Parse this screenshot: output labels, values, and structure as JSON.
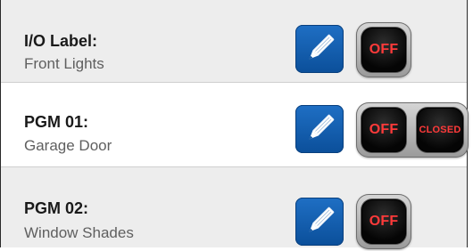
{
  "rows": [
    {
      "title": "I/O Label:",
      "subtitle": "Front Lights",
      "edit_icon": "pencil-icon",
      "toggle": "OFF"
    },
    {
      "title": "PGM 01:",
      "subtitle": "Garage Door",
      "edit_icon": "pencil-icon",
      "toggle": "OFF",
      "status": "CLOSED"
    },
    {
      "title": "PGM 02:",
      "subtitle": "Window Shades",
      "edit_icon": "pencil-icon",
      "toggle": "OFF"
    }
  ],
  "colors": {
    "edit_button": "#0b5cad",
    "toggle_text": "#ff3a3a"
  }
}
